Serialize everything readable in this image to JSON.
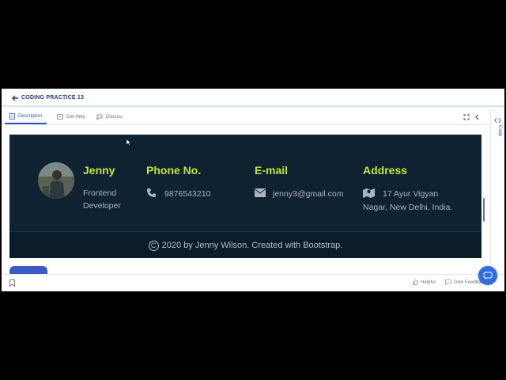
{
  "header": {
    "title": "CODING PRACTICE 13"
  },
  "tabs": [
    {
      "label": "Description",
      "active": true
    },
    {
      "label": "Get Help"
    },
    {
      "label": "Discuss"
    }
  ],
  "side_rail": {
    "label": "Code"
  },
  "footer": {
    "profile": {
      "name": "Jenny",
      "role_line1": "Frontend",
      "role_line2": "Developer"
    },
    "phone": {
      "title": "Phone No.",
      "value": "9876543210"
    },
    "email": {
      "title": "E-mail",
      "value": "jenny3@gmail.com"
    },
    "address": {
      "title": "Address",
      "line1": "17 Ayur Vigyan",
      "line2": "Nagar, New Delhi, India."
    },
    "copyright": "2020 by Jenny Wilson. Created with Bootstrap."
  },
  "bottom_bar": {
    "helpful_label": "Helpful",
    "feedback_label": "Give Feedback"
  },
  "colors": {
    "accent": "#c4e535",
    "footer_bg": "#0e2232",
    "primary": "#2b56b8"
  },
  "icons": [
    "back-arrow-icon",
    "document-icon",
    "help-icon",
    "chat-icon",
    "expand-icon",
    "chevron-left-icon",
    "code-icon",
    "phone-icon",
    "envelope-icon",
    "map-icon",
    "bookmark-icon",
    "thumbs-up-icon",
    "feedback-icon"
  ]
}
